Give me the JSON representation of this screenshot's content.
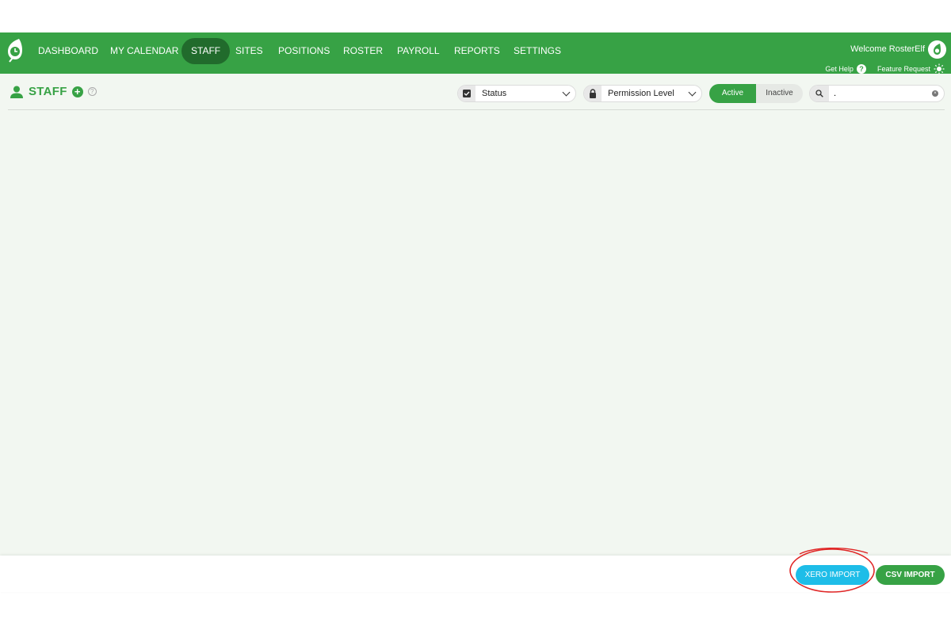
{
  "nav": {
    "items": [
      {
        "label": "DASHBOARD"
      },
      {
        "label": "MY CALENDAR"
      },
      {
        "label": "STAFF",
        "active": true
      },
      {
        "label": "SITES"
      },
      {
        "label": "POSITIONS"
      },
      {
        "label": "ROSTER"
      },
      {
        "label": "PAYROLL"
      },
      {
        "label": "REPORTS"
      },
      {
        "label": "SETTINGS"
      }
    ],
    "welcome": "Welcome RosterElf",
    "get_help": "Get Help",
    "feature_request": "Feature Request"
  },
  "page": {
    "title": "STAFF"
  },
  "filters": {
    "status_label": "Status",
    "permission_label": "Permission Level",
    "toggle_active": "Active",
    "toggle_inactive": "Inactive",
    "search_value": "."
  },
  "footer": {
    "xero_import": "XERO IMPORT",
    "csv_import": "CSV IMPORT"
  },
  "colors": {
    "brand_green": "#37a245",
    "nav_active": "#216b2c",
    "xero_blue": "#1ebde8",
    "annotation_red": "#e02626"
  }
}
